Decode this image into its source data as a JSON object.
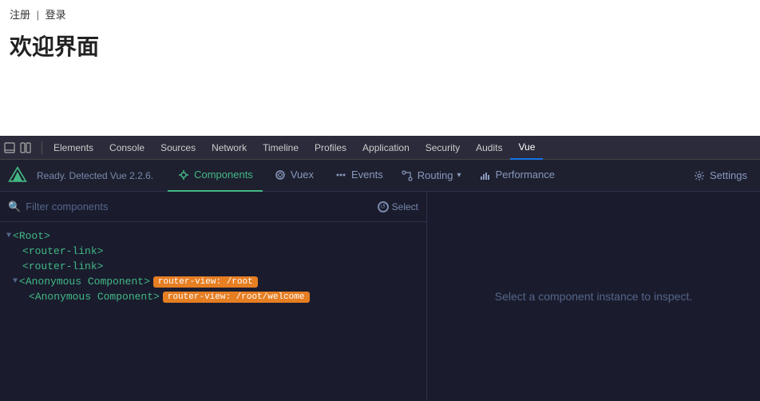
{
  "page": {
    "nav": {
      "register": "注册",
      "separator": "|",
      "login": "登录"
    },
    "title": "欢迎界面"
  },
  "devtools": {
    "topbar": {
      "tabs": [
        {
          "label": "Elements",
          "active": false
        },
        {
          "label": "Console",
          "active": false
        },
        {
          "label": "Sources",
          "active": false
        },
        {
          "label": "Network",
          "active": false
        },
        {
          "label": "Timeline",
          "active": false
        },
        {
          "label": "Profiles",
          "active": false
        },
        {
          "label": "Application",
          "active": false
        },
        {
          "label": "Security",
          "active": false
        },
        {
          "label": "Audits",
          "active": false
        },
        {
          "label": "Vue",
          "active": true
        }
      ]
    },
    "vue_bar": {
      "status": "Ready. Detected Vue 2.2.6.",
      "tabs": [
        {
          "label": "Components",
          "icon": "component",
          "active": true
        },
        {
          "label": "Vuex",
          "icon": "vuex",
          "active": false
        },
        {
          "label": "Events",
          "icon": "events",
          "active": false
        },
        {
          "label": "Routing",
          "icon": "routing",
          "active": false,
          "has_chevron": true
        },
        {
          "label": "Performance",
          "icon": "performance",
          "active": false
        },
        {
          "label": "Settings",
          "icon": "settings",
          "active": false
        }
      ]
    },
    "filter": {
      "placeholder": "Filter components",
      "select_label": "Select"
    },
    "tree": {
      "items": [
        {
          "indent": 0,
          "arrow": "▼",
          "text": "<Root>",
          "badge": null
        },
        {
          "indent": 1,
          "arrow": null,
          "text": "<router-link>",
          "badge": null
        },
        {
          "indent": 1,
          "arrow": null,
          "text": "<router-link>",
          "badge": null
        },
        {
          "indent": 1,
          "arrow": "▼",
          "text": "<Anonymous Component>",
          "badge": "router-view: /root"
        },
        {
          "indent": 2,
          "arrow": null,
          "text": "<Anonymous Component>",
          "badge": "router-view: /root/welcome"
        }
      ]
    },
    "inspect_hint": "Select a component instance to inspect."
  }
}
